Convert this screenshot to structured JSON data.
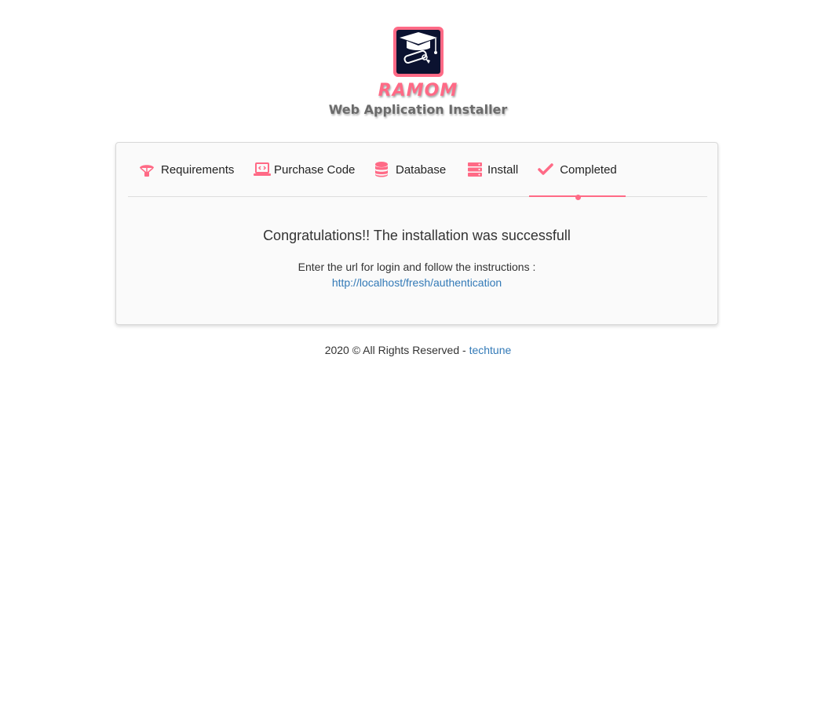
{
  "brand": {
    "name": "RAMOM",
    "subtitle": "Web Application Installer",
    "logo_icon": "graduation-cap-diploma-icon"
  },
  "tabs": [
    {
      "label": "Requirements",
      "icon": "parachute-icon",
      "active": false
    },
    {
      "label": "Purchase Code",
      "icon": "laptop-code-icon",
      "active": false
    },
    {
      "label": "Database",
      "icon": "database-icon",
      "active": false
    },
    {
      "label": "Install",
      "icon": "server-icon",
      "active": false
    },
    {
      "label": "Completed",
      "icon": "check-icon",
      "active": true
    }
  ],
  "content": {
    "heading": "Congratulations!! The installation was successfull",
    "instruction": "Enter the url for login and follow the instructions :",
    "login_url": "http://localhost/fresh/authentication"
  },
  "footer": {
    "text": "2020 © All Rights Reserved - ",
    "link_text": "techtune"
  },
  "colors": {
    "accent": "#ff6a86",
    "link": "#337ab7",
    "logo_bg": "#0b1230"
  }
}
